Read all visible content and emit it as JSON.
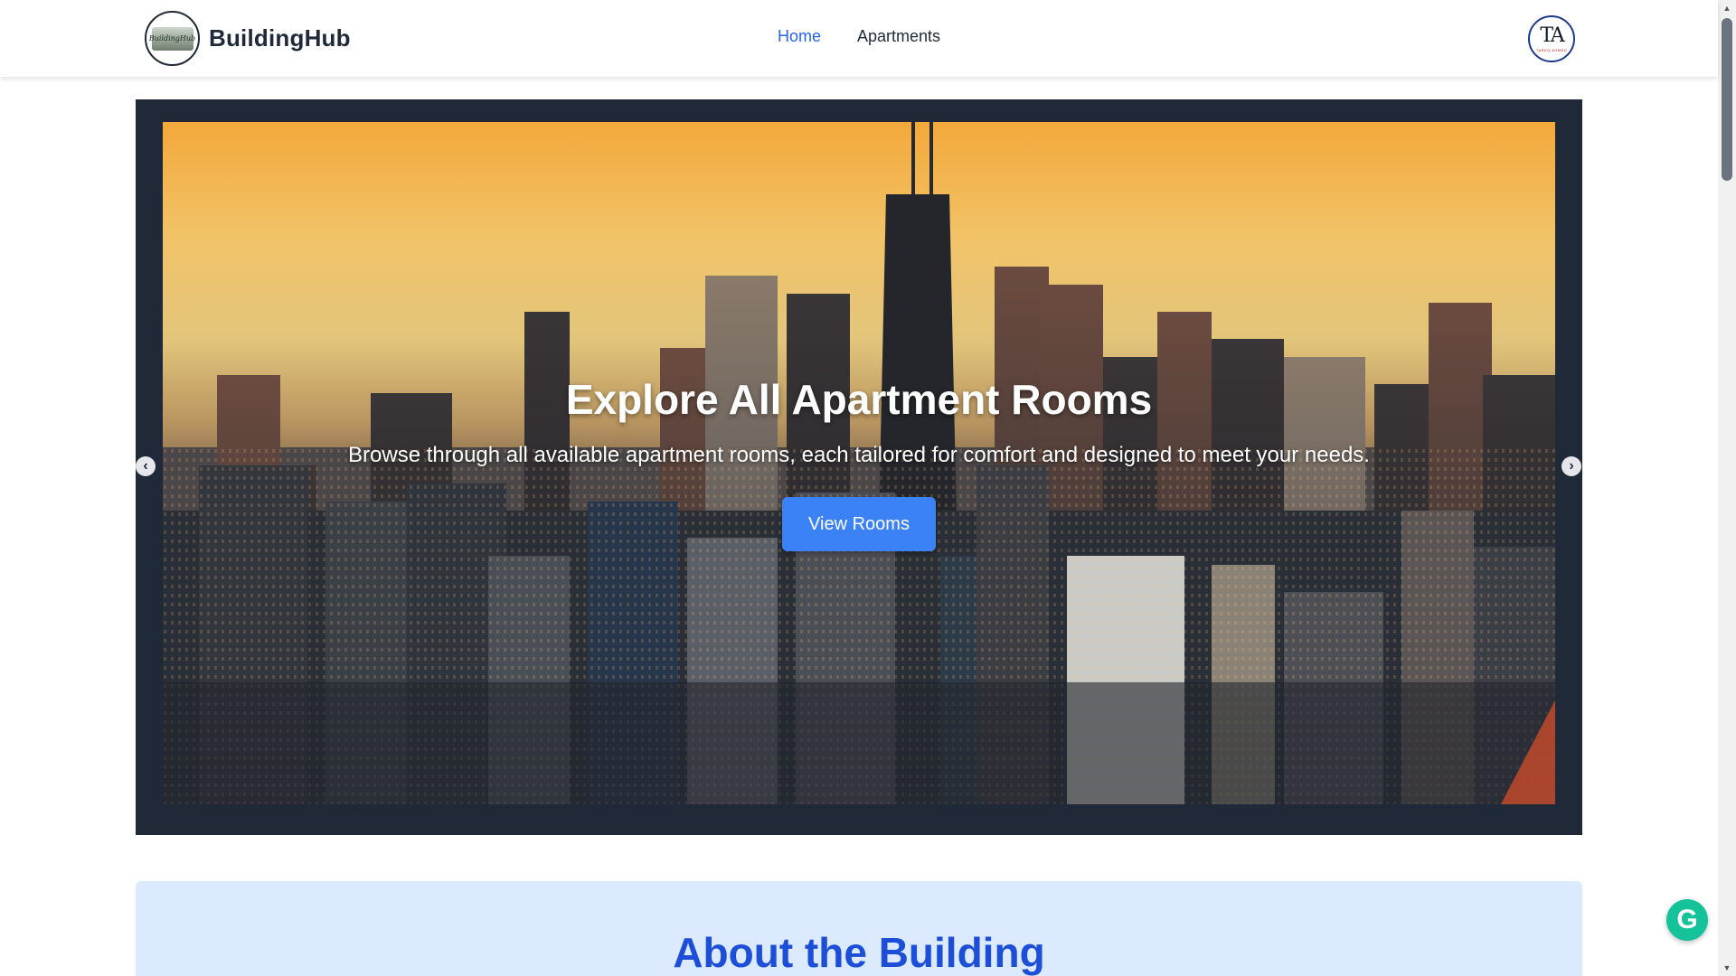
{
  "navbar": {
    "brand_name": "BuildingHub",
    "logo_text": "BuildingHub",
    "links": [
      {
        "label": "Home",
        "active": true
      },
      {
        "label": "Apartments",
        "active": false
      }
    ],
    "avatar_initials": "TA",
    "avatar_subtext": "TAREQ AHMED"
  },
  "hero": {
    "title": "Explore All Apartment Rooms",
    "subtitle": "Browse through all available apartment rooms, each tailored for comfort and designed to meet your needs.",
    "button_label": "View Rooms",
    "prev_icon": "chevron-left-icon",
    "next_icon": "chevron-right-icon",
    "prev_glyph": "‹",
    "next_glyph": "›",
    "slide_count": 3,
    "active_slide": 3
  },
  "about": {
    "title": "About the Building"
  },
  "widget": {
    "icon": "grammarly-icon",
    "glyph": "G"
  },
  "colors": {
    "accent": "#3b82f6",
    "nav_active": "#2563eb",
    "carousel_frame": "#1f2937",
    "about_bg": "#dbeafe",
    "about_title": "#1d4ed8"
  }
}
